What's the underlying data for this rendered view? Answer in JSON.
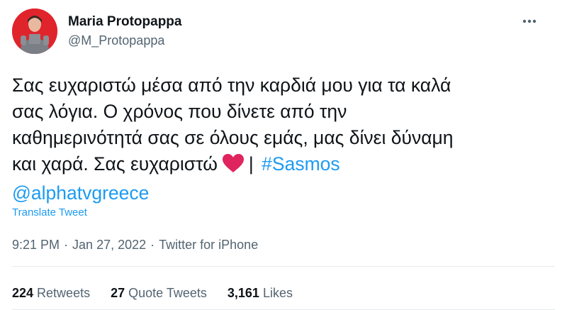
{
  "author": {
    "name": "Maria Protopappa",
    "handle": "@M_Protopappa"
  },
  "tweet": {
    "lines": [
      "Σας ευχαριστώ μέσα από την καρδιά μου για τα καλά",
      "σας λόγια. Ο χρόνος που δίνετε από την",
      "καθημερινότητά σας σε όλους εμάς, μας δίνει δύναμη",
      "και χαρά. Σας ευχαριστώ"
    ],
    "separator": "|",
    "hashtag": "#Sasmos",
    "mention": "@alphatvgreece",
    "emoji": "heart-icon"
  },
  "translate_label": "Translate Tweet",
  "meta": {
    "time": "9:21 PM",
    "dot": "·",
    "date": "Jan 27, 2022",
    "source": "Twitter for iPhone"
  },
  "stats": {
    "retweets_count": "224",
    "retweets_label": "Retweets",
    "quotes_count": "27",
    "quotes_label": "Quote Tweets",
    "likes_count": "3,161",
    "likes_label": "Likes"
  },
  "colors": {
    "link": "#1d9bf0",
    "secondary_text": "#536471",
    "heart": "#e0245e",
    "avatar_bg": "#e0242c"
  }
}
